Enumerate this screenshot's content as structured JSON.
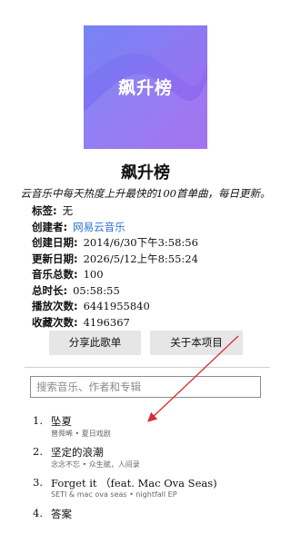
{
  "playlist": {
    "cover_text": "飙升榜",
    "title": "飙升榜",
    "description": "云音乐中每天热度上升最快的100首单曲，每日更新。",
    "meta": [
      {
        "key": "标签:",
        "value": "无"
      },
      {
        "key": "创建者:",
        "value": "网易云音乐"
      },
      {
        "key": "创建日期:",
        "value": "2014/6/30下午3:58:56"
      },
      {
        "key": "更新日期:",
        "value": "2026/5/12上午8:55:24"
      },
      {
        "key": "音乐总数:",
        "value": "100"
      },
      {
        "key": "总时长:",
        "value": "05:58:55"
      },
      {
        "key": "播放次数:",
        "value": "6441955840"
      },
      {
        "key": "收藏次数:",
        "value": "4196367"
      }
    ]
  },
  "actions": {
    "share_label": "分享此歌单",
    "about_label": "关于本项目"
  },
  "search": {
    "placeholder": "搜索音乐、作者和专辑",
    "value": ""
  },
  "tracks": [
    {
      "num": "1.",
      "title": "坠夏",
      "sub": "曾舜晞 • 夏日戏剧"
    },
    {
      "num": "2.",
      "title": "坚定的浪潮",
      "sub": "念念不忘 • 众生赋，人间录"
    },
    {
      "num": "3.",
      "title": "Forget it （feat. Mac Ova Seas)",
      "sub": "SETI & mac ova seas • nightfall EP"
    },
    {
      "num": "4.",
      "title": "答案",
      "sub": ""
    }
  ],
  "colors": {
    "accent_link": "#2a6fd6",
    "annotation_arrow": "#d32f2f",
    "cover_gradient": [
      "#6e7df4",
      "#9b63ee"
    ]
  }
}
